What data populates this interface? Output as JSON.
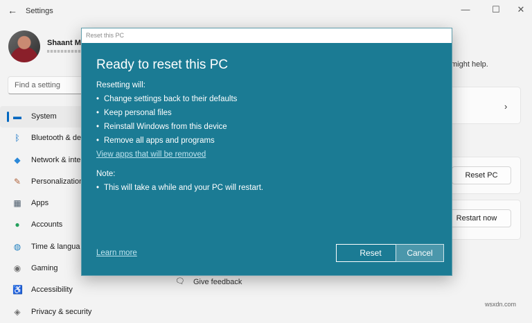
{
  "window": {
    "title": "Settings",
    "back_glyph": "←",
    "min_glyph": "—",
    "max_glyph": "☐",
    "close_glyph": "✕"
  },
  "profile": {
    "name": "Shaant M"
  },
  "search": {
    "placeholder": "Find a setting"
  },
  "nav": {
    "items": [
      {
        "label": "System",
        "icon": "monitor-icon",
        "glyph": "▬",
        "color": "#0067c0"
      },
      {
        "label": "Bluetooth & de",
        "icon": "bluetooth-icon",
        "glyph": "ᛒ",
        "color": "#0067c0"
      },
      {
        "label": "Network & inte",
        "icon": "wifi-icon",
        "glyph": "◆",
        "color": "#2b88d8"
      },
      {
        "label": "Personalization",
        "icon": "brush-icon",
        "glyph": "✎",
        "color": "#b0643c"
      },
      {
        "label": "Apps",
        "icon": "apps-icon",
        "glyph": "▦",
        "color": "#4a5a6a"
      },
      {
        "label": "Accounts",
        "icon": "person-icon",
        "glyph": "●",
        "color": "#25a05d"
      },
      {
        "label": "Time & langua",
        "icon": "globe-icon",
        "glyph": "◍",
        "color": "#1f7fbf"
      },
      {
        "label": "Gaming",
        "icon": "gamepad-icon",
        "glyph": "◉",
        "color": "#6d6d6d"
      },
      {
        "label": "Accessibility",
        "icon": "accessibility-icon",
        "glyph": "♿",
        "color": "#1f6fbf"
      },
      {
        "label": "Privacy & security",
        "icon": "shield-icon",
        "glyph": "◈",
        "color": "#6d6d6d"
      }
    ]
  },
  "panel": {
    "help_text": "might help.",
    "chevron": "›",
    "reset_pc_label": "Reset PC",
    "restart_now_label": "Restart now",
    "feedback_label": "Give feedback"
  },
  "dialog": {
    "title": "Reset this PC",
    "heading": "Ready to reset this PC",
    "resetting_will": "Resetting will:",
    "bullets": [
      "Change settings back to their defaults",
      "Keep personal files",
      "Reinstall Windows from this device",
      "Remove all apps and programs"
    ],
    "view_apps_link": "View apps that will be removed",
    "note_label": "Note:",
    "note_bullets": [
      "This will take a while and your PC will restart."
    ],
    "learn_more_link": "Learn more",
    "reset_button": "Reset",
    "cancel_button": "Cancel"
  },
  "watermark": "wsxdn.com",
  "colors": {
    "dialog_bg": "#1b7b94",
    "accent": "#0067c0"
  }
}
